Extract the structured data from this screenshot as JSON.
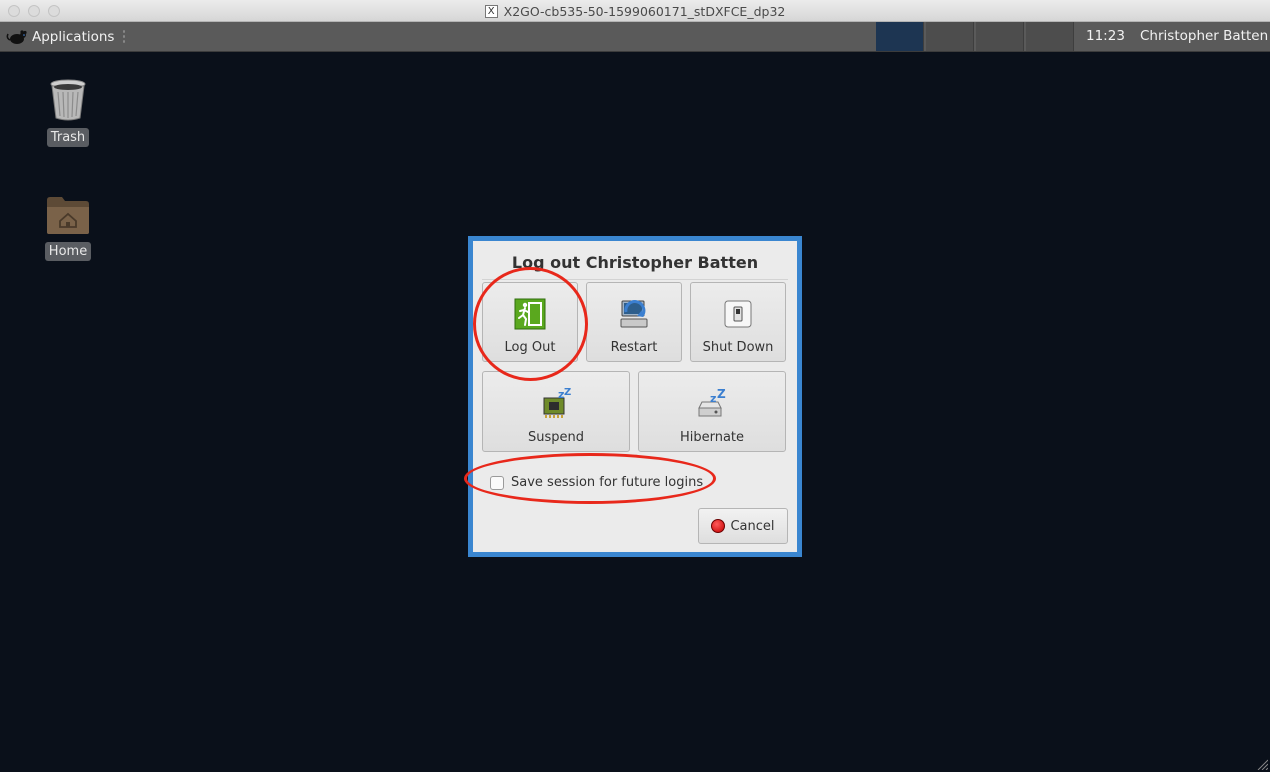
{
  "window": {
    "title": "X2GO-cb535-50-1599060171_stDXFCE_dp32",
    "x_glyph": "X"
  },
  "panel": {
    "applications_label": "Applications",
    "clock": "11:23",
    "user": "Christopher Batten"
  },
  "desktop": {
    "icons": [
      {
        "label": "Trash",
        "icon": "trash-icon"
      },
      {
        "label": "Home",
        "icon": "home-folder-icon"
      }
    ]
  },
  "dialog": {
    "title": "Log out Christopher Batten",
    "actions": [
      {
        "label": "Log Out",
        "icon": "exit-icon"
      },
      {
        "label": "Restart",
        "icon": "restart-icon"
      },
      {
        "label": "Shut Down",
        "icon": "power-switch-icon"
      },
      {
        "label": "Suspend",
        "icon": "suspend-chip-icon"
      },
      {
        "label": "Hibernate",
        "icon": "hibernate-disk-icon"
      }
    ],
    "save_session_label": "Save session for future logins",
    "save_session_checked": false,
    "cancel_label": "Cancel"
  },
  "colors": {
    "desktop_bg": "#0a101a",
    "panel_bg": "#5a5a5a",
    "dialog_border": "#3a86d0",
    "annotation": "#e8281b"
  }
}
